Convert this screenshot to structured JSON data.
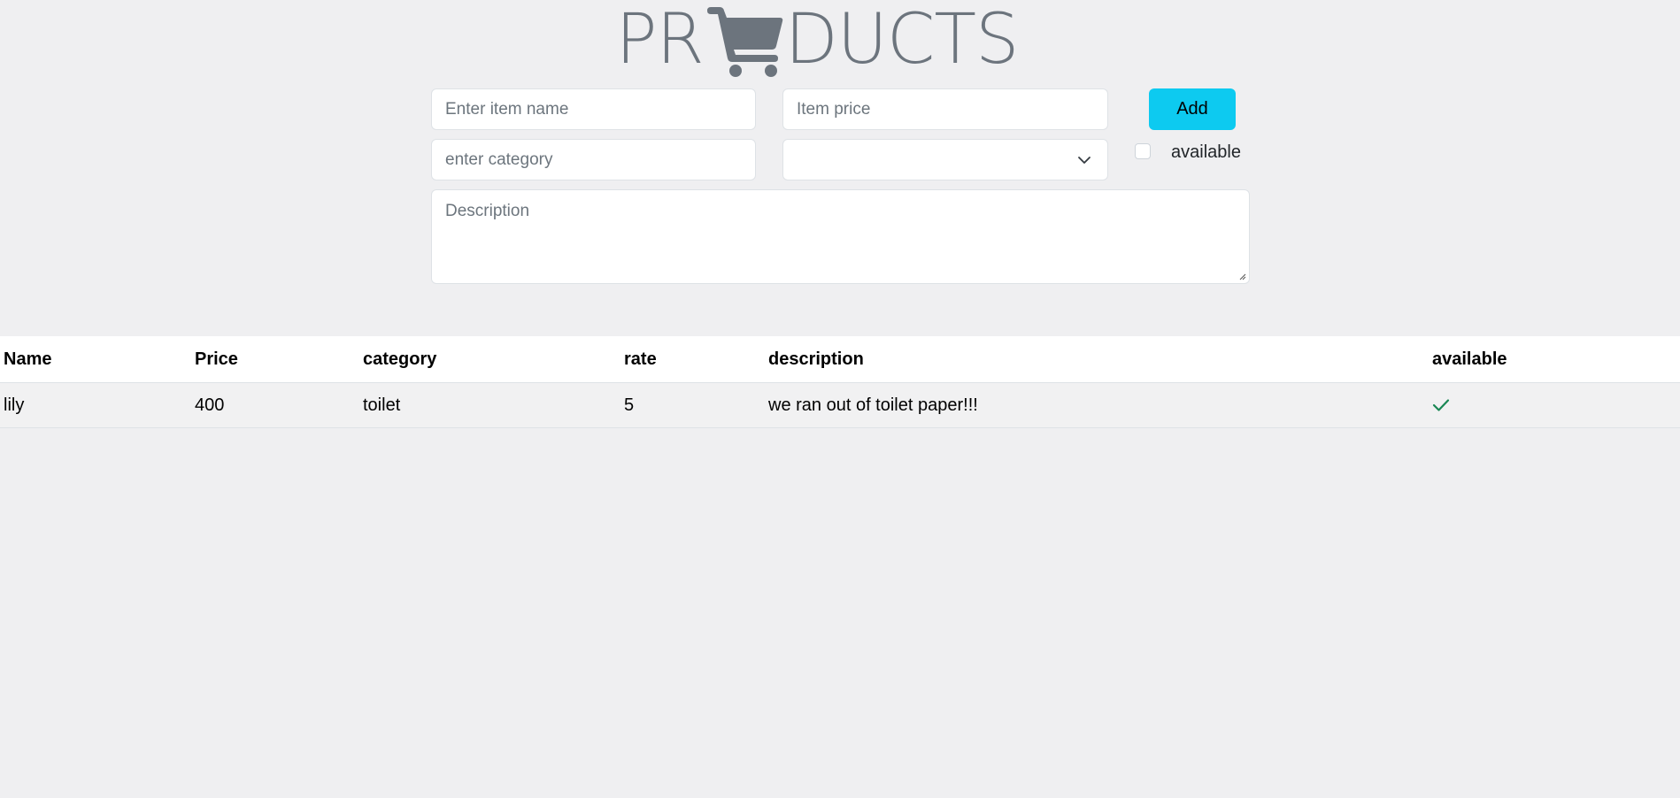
{
  "header": {
    "title_left": "PR",
    "title_right": "DUCTS",
    "logo_icon": "shopping-cart-icon",
    "title_color": "#6c747d"
  },
  "form": {
    "item_name_placeholder": "Enter item name",
    "item_price_placeholder": "Item price",
    "category_placeholder": "enter category",
    "select_value": "",
    "description_placeholder": "Description",
    "add_label": "Add",
    "available_label": "available",
    "available_checked": false,
    "add_color": "#0dcaf0"
  },
  "table": {
    "columns": [
      "Name",
      "Price",
      "category",
      "rate",
      "description",
      "available"
    ],
    "rows": [
      {
        "name": "lily",
        "price": "400",
        "category": "toilet",
        "rate": "5",
        "description": "we ran out of toilet paper!!!",
        "available": "check-icon"
      }
    ],
    "check_color": "#198754"
  }
}
